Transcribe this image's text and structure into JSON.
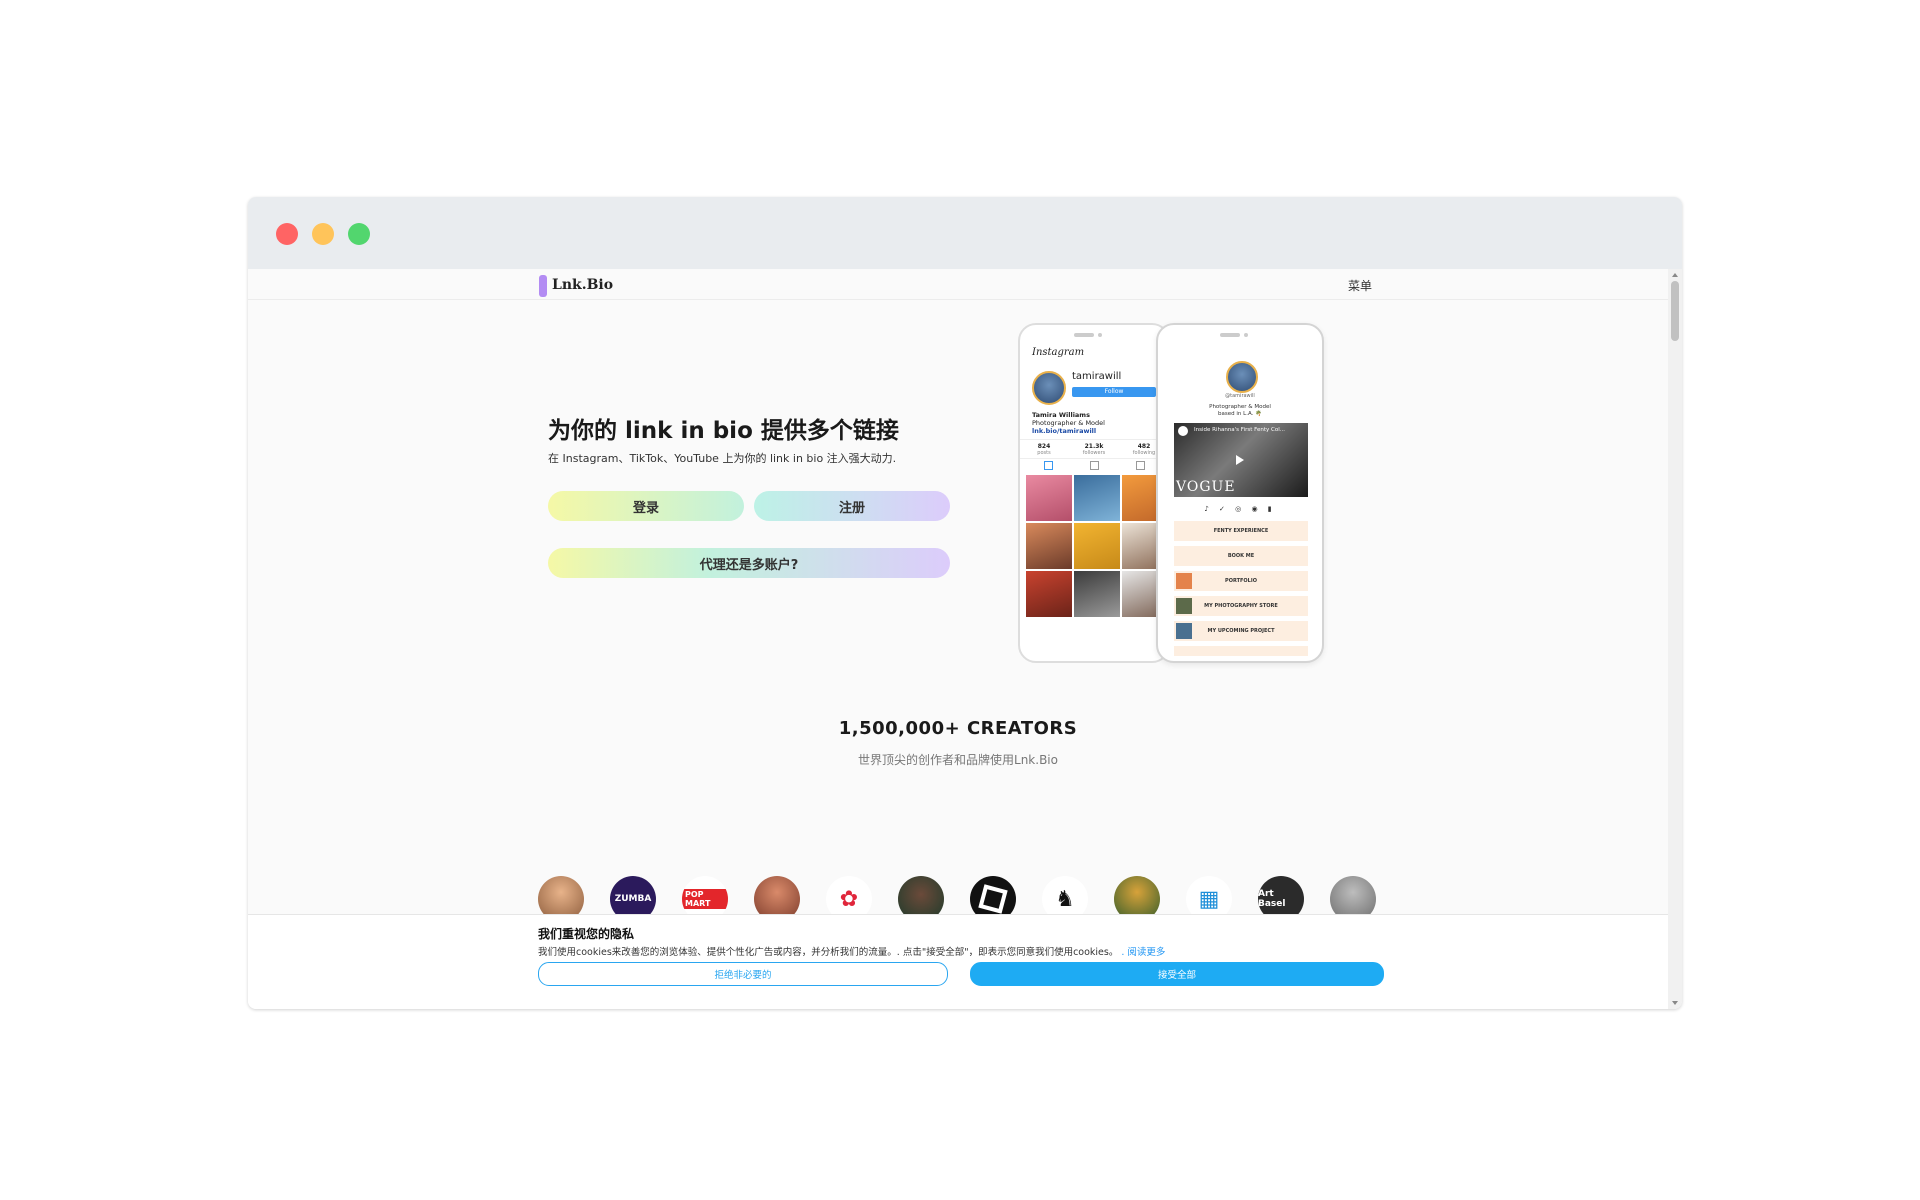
{
  "window": {
    "controls": [
      "close",
      "minimize",
      "maximize"
    ]
  },
  "nav": {
    "logo": "Lnk.Bio",
    "menu_label": "菜单"
  },
  "hero": {
    "title": "为你的 link in bio 提供多个链接",
    "subtitle": "在 Instagram、TikTok、YouTube 上为你的 link in bio 注入强大动力.",
    "login_label": "登录",
    "register_label": "注册",
    "agency_label": "代理还是多账户?"
  },
  "mockup": {
    "instagram": {
      "logo": "Instagram",
      "username": "tamirawill",
      "follow": "Follow",
      "bio_name": "Tamira Williams",
      "bio_line": "Photographer & Model",
      "bio_link": "lnk.bio/tamirawill",
      "stats": [
        {
          "num": "824",
          "label": "posts"
        },
        {
          "num": "21.3k",
          "label": "followers"
        },
        {
          "num": "482",
          "label": "following"
        }
      ]
    },
    "linkbio": {
      "handle": "@tamirawill",
      "desc1": "Photographer & Model",
      "desc2": "based in L.A. 🌴",
      "video_title": "Inside Rihanna's First Fenty Col...",
      "video_brand": "VOGUE",
      "socials": "♪ ✓ ◎ ◉ ▮",
      "links": [
        "FENTY EXPERIENCE",
        "BOOK ME",
        "PORTFOLIO",
        "MY PHOTOGRAPHY STORE",
        "MY UPCOMING PROJECT"
      ]
    }
  },
  "creators": {
    "title": "1,500,000+ CREATORS",
    "subtitle": "世界顶尖的创作者和品牌使用Lnk.Bio",
    "brands": [
      "",
      "ZUMBA",
      "POP MART",
      "",
      "",
      "",
      "",
      "",
      "",
      "",
      "Art Basel",
      ""
    ]
  },
  "cookie": {
    "title": "我们重视您的隐私",
    "text": "我们使用cookies来改善您的浏览体验、提供个性化广告或内容，并分析我们的流量。. 点击\"接受全部\"，即表示您同意我们使用cookies。",
    "read_more": ". 阅读更多",
    "reject_label": "拒绝非必要的",
    "accept_label": "接受全部"
  },
  "colors": {
    "logo_accent": "#b38cf3",
    "cookie_accept": "#1eabf3",
    "close_dot": "#ff6464",
    "minimize_dot": "#ffc45a",
    "maximize_dot": "#52d66e"
  }
}
